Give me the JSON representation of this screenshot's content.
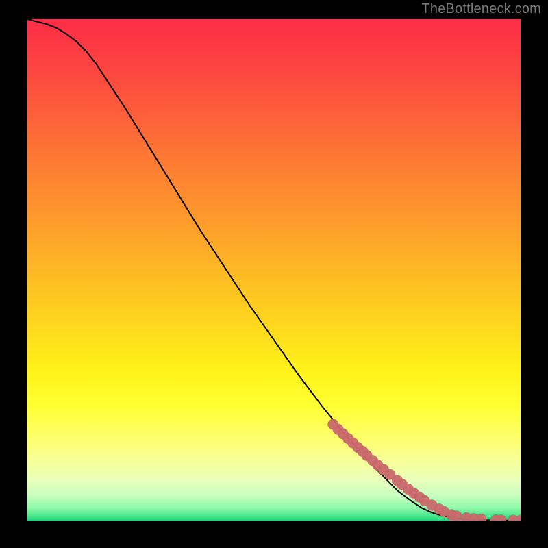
{
  "watermark": "TheBottleneck.com",
  "chart_data": {
    "type": "line",
    "title": "",
    "xlabel": "",
    "ylabel": "",
    "xlim": [
      0,
      100
    ],
    "ylim": [
      0,
      100
    ],
    "grid": false,
    "series": [
      {
        "name": "curve",
        "kind": "line",
        "color": "#000000",
        "x": [
          0,
          2,
          4,
          6,
          8,
          10,
          12,
          14,
          16,
          18,
          20,
          25,
          30,
          35,
          40,
          45,
          50,
          55,
          60,
          65,
          70,
          75,
          78,
          80,
          82,
          84,
          86,
          88,
          90,
          92,
          94,
          96,
          98,
          100
        ],
        "y": [
          100,
          99.5,
          99,
          98.2,
          97,
          95.5,
          93.5,
          91,
          88,
          85,
          82,
          74,
          66,
          58,
          50.5,
          43,
          36,
          29,
          22.5,
          16.5,
          11,
          6,
          3.8,
          2.5,
          1.6,
          1.0,
          0.6,
          0.35,
          0.2,
          0.12,
          0.07,
          0.04,
          0.02,
          0.01
        ]
      },
      {
        "name": "points",
        "kind": "scatter",
        "color": "#c9686b",
        "x": [
          62,
          63,
          64,
          65,
          66,
          67,
          68,
          68.8,
          70,
          71,
          72.2,
          73.5,
          75,
          76,
          77.2,
          78.3,
          79.5,
          80.5,
          82,
          83.5,
          84.5,
          86,
          87,
          89,
          90.5,
          92,
          95,
          96,
          98.5,
          100
        ],
        "y": [
          19.2,
          18.2,
          17.3,
          16.4,
          15.5,
          14.6,
          13.8,
          13.0,
          12.0,
          11.1,
          10.2,
          9.2,
          8.0,
          7.2,
          6.3,
          5.5,
          4.7,
          4.0,
          3.1,
          2.3,
          1.8,
          1.2,
          0.9,
          0.55,
          0.4,
          0.3,
          0.15,
          0.12,
          0.07,
          0.05
        ]
      }
    ],
    "background_gradient": {
      "stops": [
        {
          "offset": 0.0,
          "color": "#fc2d46"
        },
        {
          "offset": 0.1,
          "color": "#fd4540"
        },
        {
          "offset": 0.2,
          "color": "#fd6239"
        },
        {
          "offset": 0.3,
          "color": "#fd7f32"
        },
        {
          "offset": 0.4,
          "color": "#fe9b2c"
        },
        {
          "offset": 0.5,
          "color": "#feb825"
        },
        {
          "offset": 0.6,
          "color": "#fed51e"
        },
        {
          "offset": 0.7,
          "color": "#fff218"
        },
        {
          "offset": 0.77,
          "color": "#ffff33"
        },
        {
          "offset": 0.83,
          "color": "#feff66"
        },
        {
          "offset": 0.88,
          "color": "#f8ff99"
        },
        {
          "offset": 0.92,
          "color": "#e9ffbb"
        },
        {
          "offset": 0.95,
          "color": "#c7ffc0"
        },
        {
          "offset": 0.975,
          "color": "#8cf9a8"
        },
        {
          "offset": 0.99,
          "color": "#4de98f"
        },
        {
          "offset": 1.0,
          "color": "#17d879"
        }
      ]
    }
  }
}
